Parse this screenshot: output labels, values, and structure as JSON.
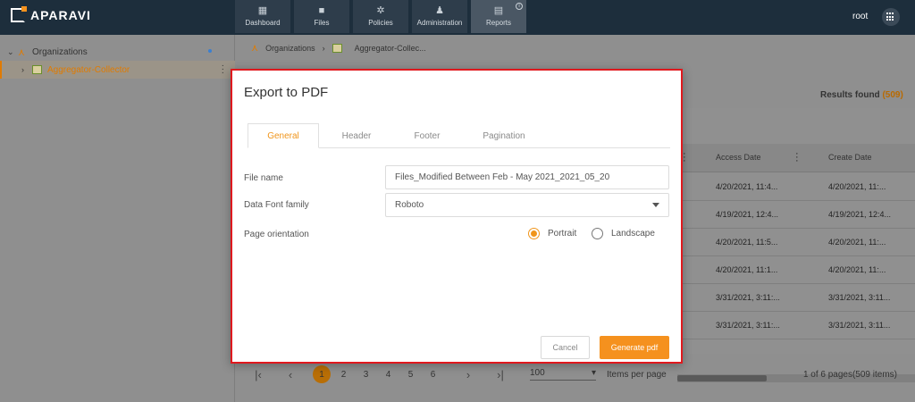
{
  "app": {
    "logo": "APARAVI",
    "user": "root"
  },
  "nav": [
    {
      "label": "Dashboard",
      "icon": "dashboard-icon",
      "active": false
    },
    {
      "label": "Files",
      "icon": "folder-icon",
      "active": false
    },
    {
      "label": "Policies",
      "icon": "gear-icon",
      "active": false
    },
    {
      "label": "Administration",
      "icon": "users-icon",
      "active": false
    },
    {
      "label": "Reports",
      "icon": "clipboard-icon",
      "active": true
    }
  ],
  "sidebar": {
    "root": "Organizations",
    "child": "Aggregator-Collector"
  },
  "breadcrumb": [
    "Organizations",
    "Aggregator-Collec..."
  ],
  "results": {
    "label": "Results found",
    "count": "(509)"
  },
  "grid": {
    "columns": [
      "Access Date",
      "Create Date"
    ],
    "rows": [
      [
        "4/20/2021, 11:4...",
        "4/20/2021, 11:..."
      ],
      [
        "4/19/2021, 12:4...",
        "4/19/2021, 12:4..."
      ],
      [
        "4/20/2021, 11:5...",
        "4/20/2021, 11:..."
      ],
      [
        "4/20/2021, 11:1...",
        "4/20/2021, 11:..."
      ],
      [
        "3/31/2021, 3:11:...",
        "3/31/2021, 3:11..."
      ],
      [
        "3/31/2021, 3:11:...",
        "3/31/2021, 3:11..."
      ]
    ]
  },
  "pager": {
    "pages": [
      "1",
      "2",
      "3",
      "4",
      "5",
      "6"
    ],
    "current": "1",
    "per_page": "100",
    "per_page_label": "Items per page",
    "info": "1 of 6 pages(509 items)"
  },
  "modal": {
    "title": "Export to PDF",
    "tabs": [
      "General",
      "Header",
      "Footer",
      "Pagination"
    ],
    "active_tab": "General",
    "file_name_label": "File name",
    "file_name_value": "Files_Modified Between Feb - May 2021_2021_05_20",
    "font_label": "Data Font family",
    "font_value": "Roboto",
    "orientation_label": "Page orientation",
    "orientation_options": [
      "Portrait",
      "Landscape"
    ],
    "orientation_selected": "Portrait",
    "cancel_label": "Cancel",
    "generate_label": "Generate pdf"
  },
  "colors": {
    "accent": "#f5911e",
    "topbar": "#1d2e3c",
    "highlight_border": "#e0191e"
  }
}
